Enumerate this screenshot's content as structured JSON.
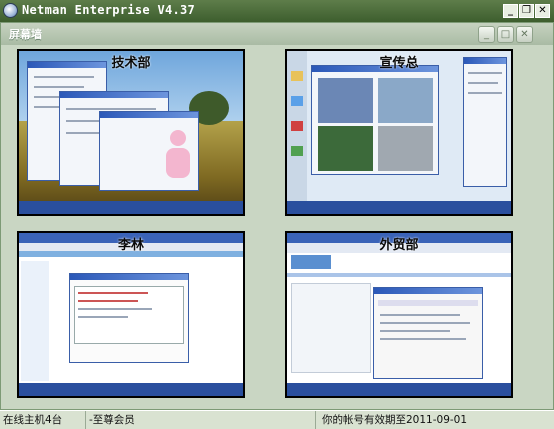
{
  "window": {
    "title": "Netman Enterprise V4.37"
  },
  "window_buttons": {
    "minimize": "_",
    "restore": "❐",
    "close": "✕"
  },
  "panel": {
    "title": "屏幕墙",
    "buttons": {
      "minimize": "_",
      "maximize": "□",
      "close": "✕"
    }
  },
  "screens": [
    {
      "label": "技术部"
    },
    {
      "label": "宣传总"
    },
    {
      "label": "李林"
    },
    {
      "label": "外贸部"
    }
  ],
  "status": {
    "online": "在线主机4台",
    "member": "-至尊会员",
    "expiry": "你的帐号有效期至2011-09-01"
  }
}
